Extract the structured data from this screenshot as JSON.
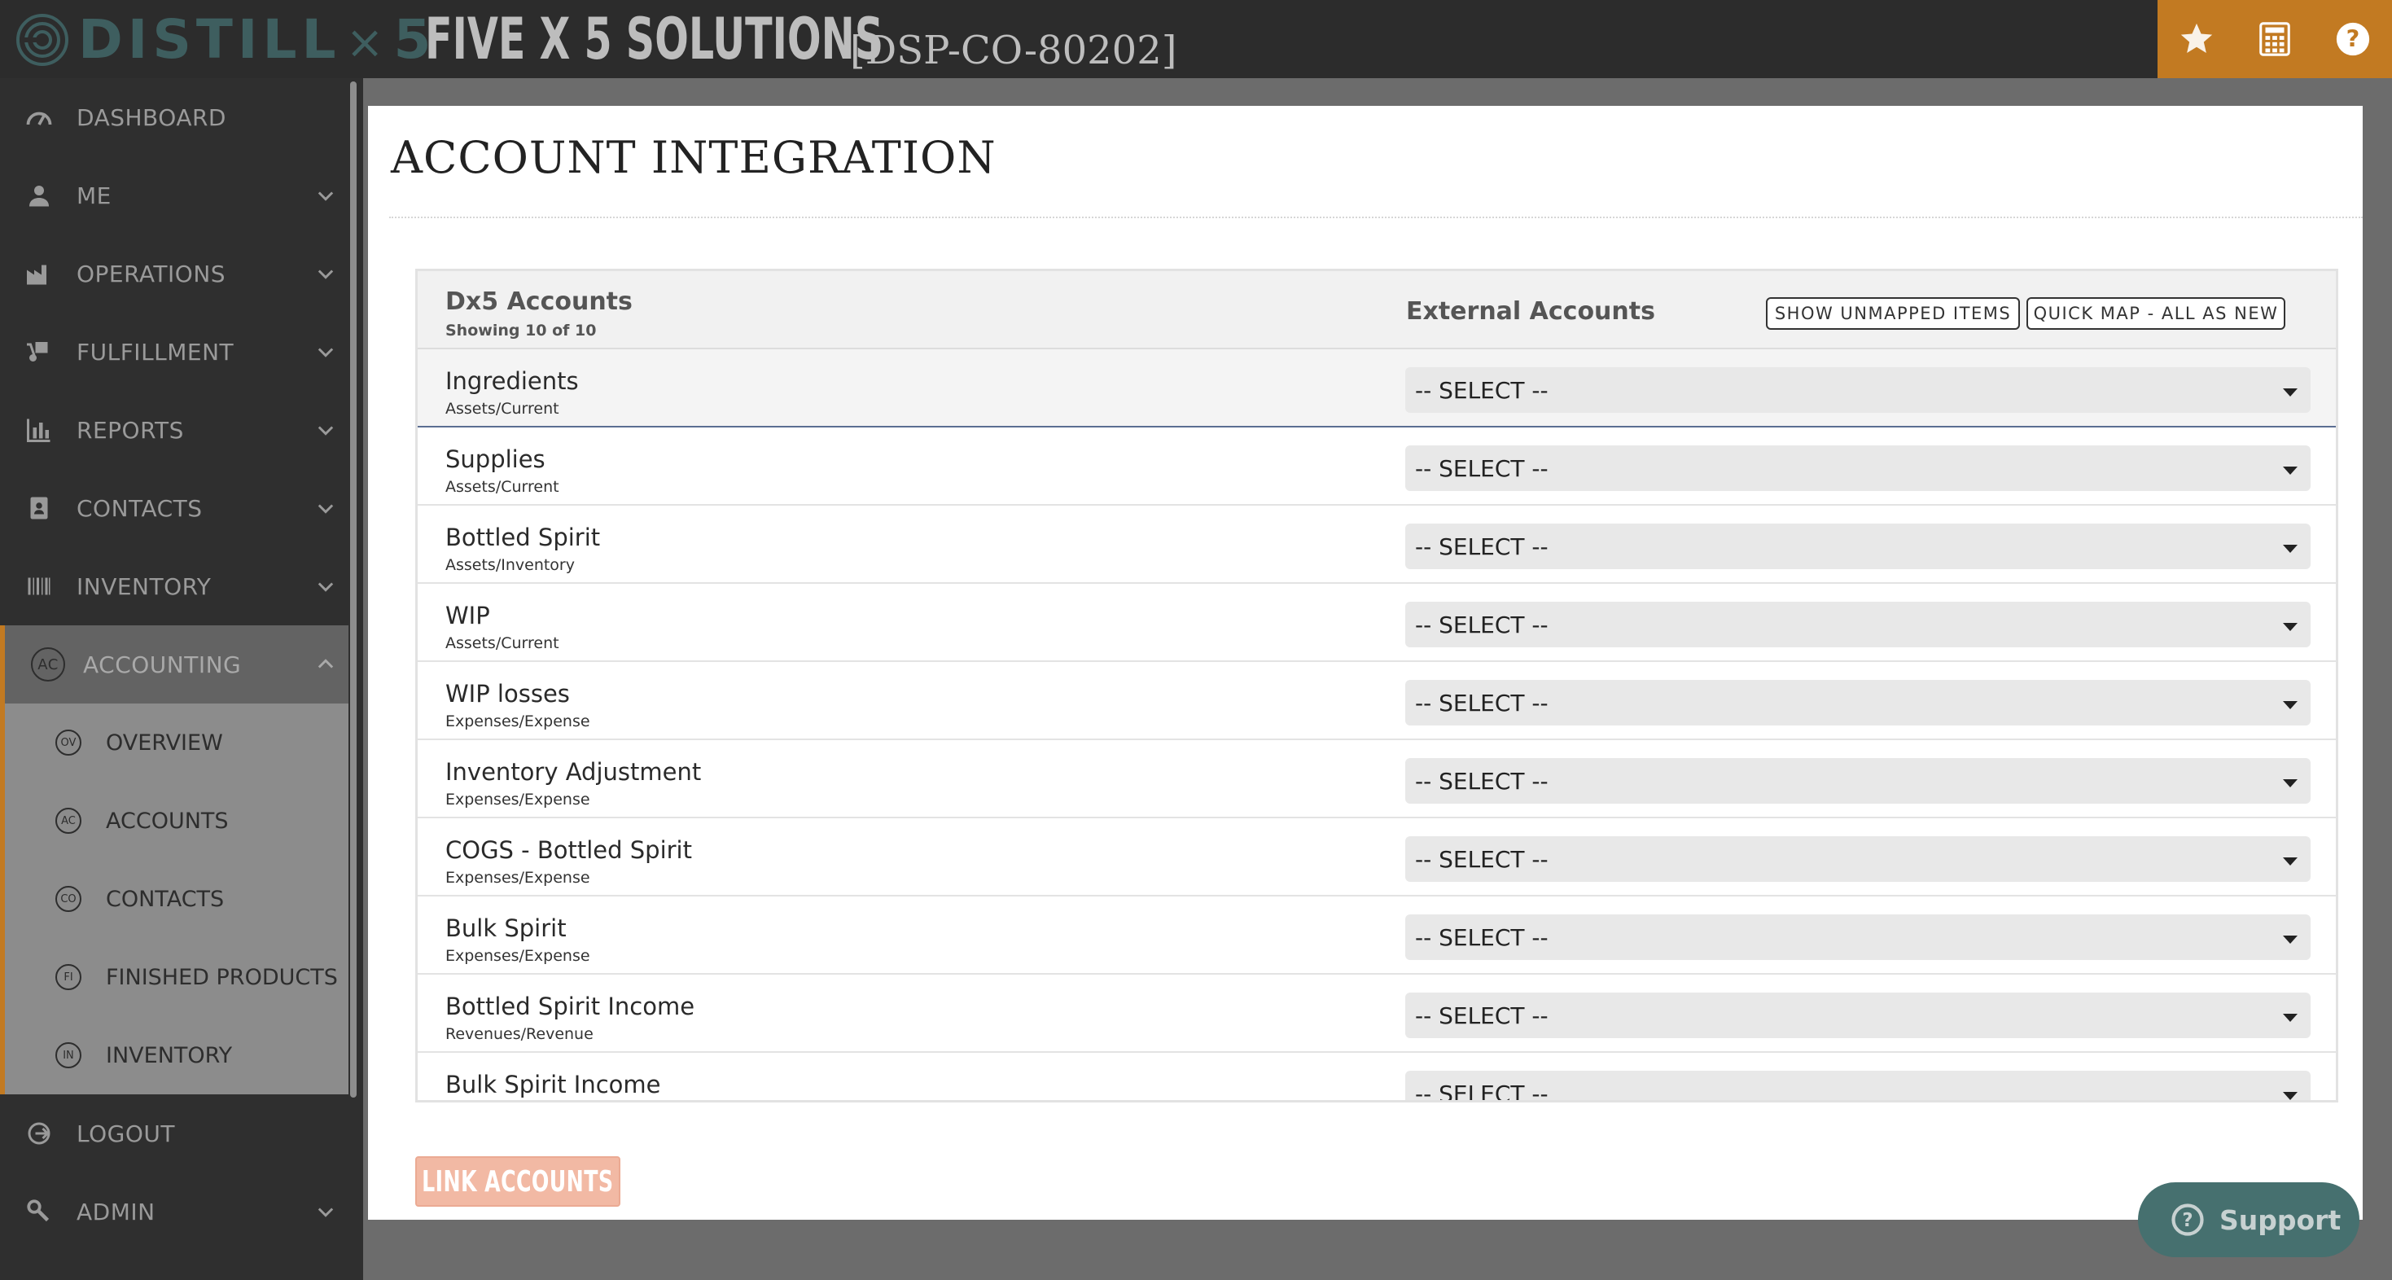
{
  "header": {
    "brand": {
      "word1": "DISTILL",
      "x": "×",
      "word2": "5"
    },
    "company": "FIVE X 5 SOLUTIONS",
    "company_code": "[DSP-CO-80202]",
    "accent_color": "#c27a22",
    "buttons": [
      {
        "icon": "star-icon"
      },
      {
        "icon": "calculator-icon"
      },
      {
        "icon": "help-icon"
      }
    ]
  },
  "sidebar": {
    "items": [
      {
        "label": "DASHBOARD",
        "icon": "dashboard-icon",
        "has_chevron": false
      },
      {
        "label": "ME",
        "icon": "user-icon",
        "has_chevron": true
      },
      {
        "label": "OPERATIONS",
        "icon": "factory-icon",
        "has_chevron": true
      },
      {
        "label": "FULFILLMENT",
        "icon": "dolly-icon",
        "has_chevron": true
      },
      {
        "label": "REPORTS",
        "icon": "bar-chart-icon",
        "has_chevron": true
      },
      {
        "label": "CONTACTS",
        "icon": "address-book-icon",
        "has_chevron": true
      },
      {
        "label": "INVENTORY",
        "icon": "barcode-icon",
        "has_chevron": true
      }
    ],
    "active": {
      "label": "ACCOUNTING",
      "badge": "AC"
    },
    "sub_items": [
      {
        "label": "OVERVIEW",
        "badge": "OV"
      },
      {
        "label": "ACCOUNTS",
        "badge": "AC"
      },
      {
        "label": "CONTACTS",
        "badge": "CO"
      },
      {
        "label": "FINISHED PRODUCTS",
        "badge": "FI"
      },
      {
        "label": "INVENTORY",
        "badge": "IN"
      }
    ],
    "bottom_items": [
      {
        "label": "LOGOUT",
        "icon": "logout-icon",
        "has_chevron": false
      },
      {
        "label": "ADMIN",
        "icon": "wrench-icon",
        "has_chevron": true
      }
    ]
  },
  "main": {
    "title": "ACCOUNT INTEGRATION",
    "table": {
      "left_header": "Dx5 Accounts",
      "count_text": "Showing 10 of 10",
      "right_header": "External Accounts",
      "show_unmapped_label": "SHOW UNMAPPED ITEMS",
      "quick_map_label": "QUICK MAP - ALL AS NEW",
      "select_placeholder": "-- SELECT --",
      "rows": [
        {
          "name": "Ingredients",
          "type": "Assets/Current",
          "value": "-- SELECT --"
        },
        {
          "name": "Supplies",
          "type": "Assets/Current",
          "value": "-- SELECT --"
        },
        {
          "name": "Bottled Spirit",
          "type": "Assets/Inventory",
          "value": "-- SELECT --"
        },
        {
          "name": "WIP",
          "type": "Assets/Current",
          "value": "-- SELECT --"
        },
        {
          "name": "WIP losses",
          "type": "Expenses/Expense",
          "value": "-- SELECT --"
        },
        {
          "name": "Inventory Adjustment",
          "type": "Expenses/Expense",
          "value": "-- SELECT --"
        },
        {
          "name": "COGS - Bottled Spirit",
          "type": "Expenses/Expense",
          "value": "-- SELECT --"
        },
        {
          "name": "Bulk Spirit",
          "type": "Expenses/Expense",
          "value": "-- SELECT --"
        },
        {
          "name": "Bottled Spirit Income",
          "type": "Revenues/Revenue",
          "value": "-- SELECT --"
        },
        {
          "name": "Bulk Spirit Income",
          "type": "",
          "value": "-- SELECT --"
        }
      ]
    },
    "link_button_label": "LINK ACCOUNTS"
  },
  "support": {
    "label": "Support",
    "icon": "help-circle-icon"
  }
}
